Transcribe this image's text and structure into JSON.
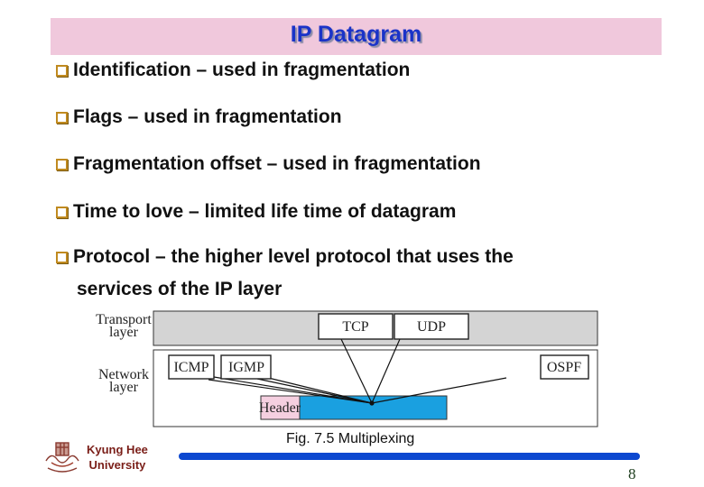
{
  "slide": {
    "title": "IP Datagram",
    "bullets": [
      {
        "text": "Identification – used in fragmentation"
      },
      {
        "text": "Flags – used in fragmentation"
      },
      {
        "text": "Fragmentation offset – used in fragmentation"
      },
      {
        "text": "Time to love – limited life time of datagram"
      },
      {
        "text": "Protocol – the higher level protocol that uses the",
        "continuation": "services of the IP layer"
      }
    ],
    "bullet_icon": "square-bullet-icon"
  },
  "diagram": {
    "layers": {
      "transport": [
        "Transport",
        "layer"
      ],
      "network": [
        "Network",
        "layer"
      ]
    },
    "protocols": {
      "tcp": "TCP",
      "udp": "UDP",
      "icmp": "ICMP",
      "igmp": "IGMP",
      "ospf": "OSPF"
    },
    "header_label": "Header",
    "colors": {
      "transport_bg": "#d4d4d4",
      "header_bg": "#f5cfe0",
      "payload_bg": "#1aa0e0"
    }
  },
  "caption": "Fig. 7.5 Multiplexing",
  "footer": {
    "university_line1": "Kyung Hee",
    "university_line2": "University",
    "page_number": "8",
    "accent_color": "#0c48d0"
  }
}
